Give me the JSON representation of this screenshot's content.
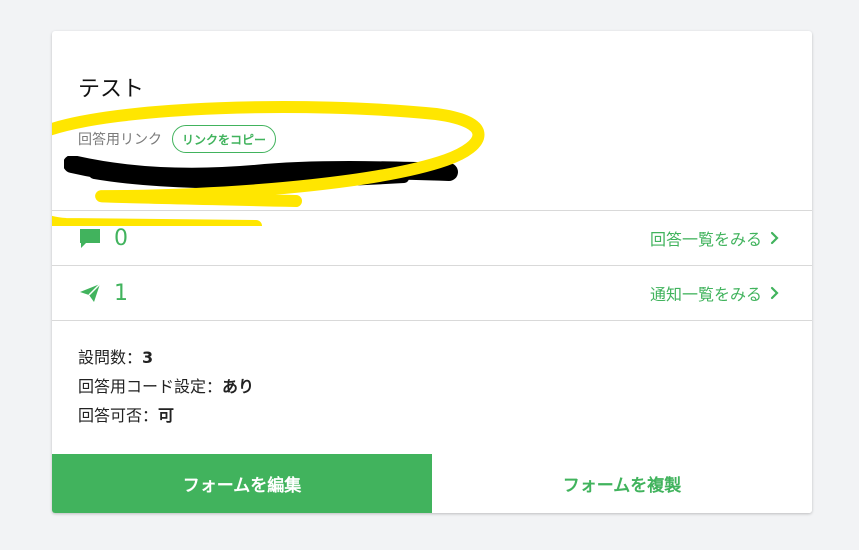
{
  "card": {
    "title": "テスト",
    "link_label": "回答用リンク",
    "copy_button": "リンクをコピー"
  },
  "stats": {
    "responses": {
      "icon": "comment-icon",
      "count": "0",
      "link": "回答一覧をみる"
    },
    "notifications": {
      "icon": "paper-plane-icon",
      "count": "1",
      "link": "通知一覧をみる"
    }
  },
  "info": {
    "questions_label": "設問数：",
    "questions_value": "3",
    "code_label": "回答用コード設定：",
    "code_value": "あり",
    "allowed_label": "回答可否：",
    "allowed_value": "可"
  },
  "buttons": {
    "edit": "フォームを編集",
    "duplicate": "フォームを複製"
  },
  "colors": {
    "accent": "#41b35d",
    "highlight": "#ffe600"
  }
}
